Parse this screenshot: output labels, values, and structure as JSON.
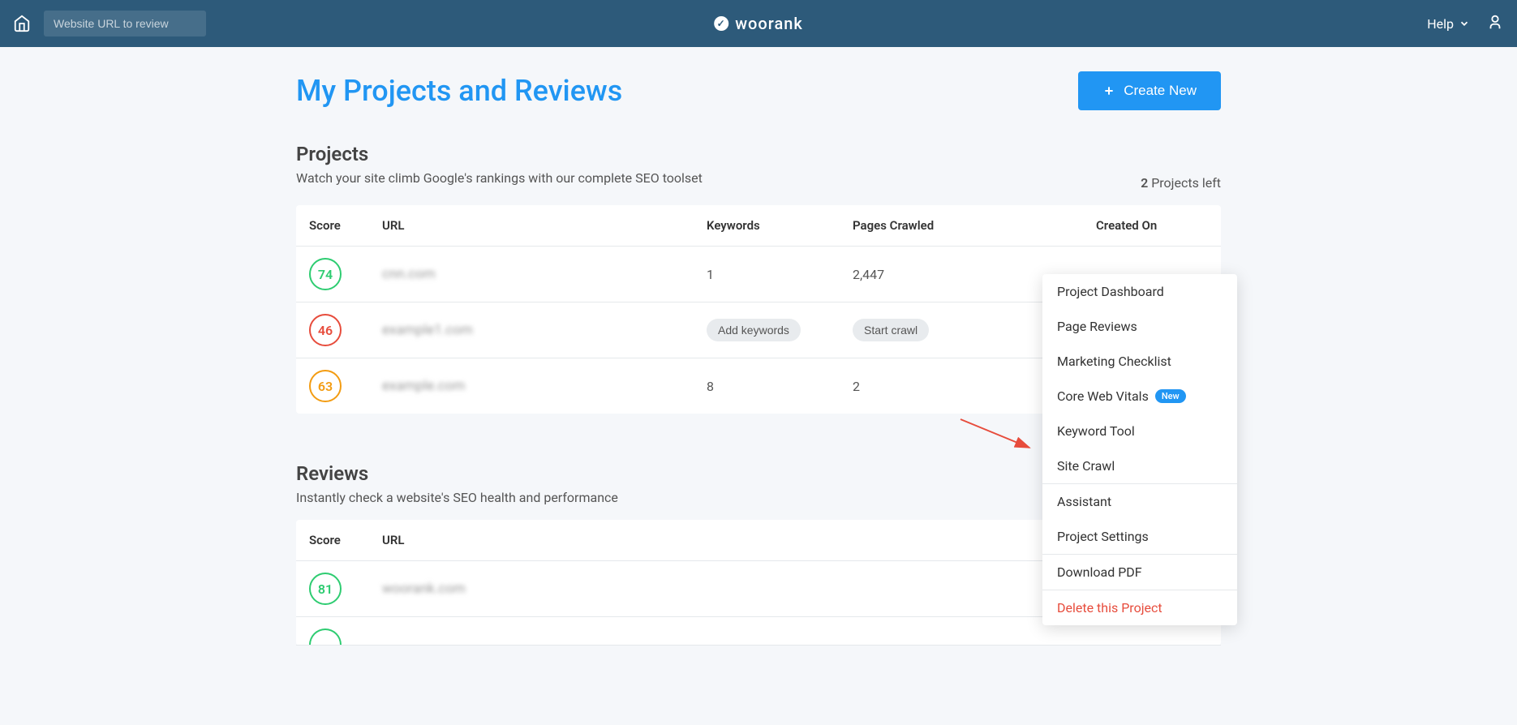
{
  "topbar": {
    "url_placeholder": "Website URL to review",
    "logo_text": "woorank",
    "help_label": "Help"
  },
  "page": {
    "title": "My Projects and Reviews",
    "create_btn_label": "Create New"
  },
  "projects": {
    "section_title": "Projects",
    "section_subtitle": "Watch your site climb Google's rankings with our complete SEO toolset",
    "left_text": "Projects left",
    "left_count": "2",
    "columns": {
      "score": "Score",
      "url": "URL",
      "keywords": "Keywords",
      "pages_crawled": "Pages Crawled",
      "created_on": "Created On"
    },
    "rows": [
      {
        "score": "74",
        "score_class": "score-green",
        "url": "cnn.com",
        "keywords": "1",
        "pages_crawled": "2,447"
      },
      {
        "score": "46",
        "score_class": "score-red",
        "url": "example1.com",
        "keywords_action": "Add keywords",
        "pages_action": "Start crawl"
      },
      {
        "score": "63",
        "score_class": "score-orange",
        "url": "example.com",
        "keywords": "8",
        "pages_crawled": "2"
      }
    ]
  },
  "reviews": {
    "section_title": "Reviews",
    "section_subtitle": "Instantly check a website's SEO health and performance",
    "columns": {
      "score": "Score",
      "url": "URL"
    },
    "rows": [
      {
        "score": "81",
        "score_class": "score-green",
        "url": "woorank.com"
      }
    ]
  },
  "dropdown": {
    "items": [
      {
        "label": "Project Dashboard"
      },
      {
        "label": "Page Reviews"
      },
      {
        "label": "Marketing Checklist"
      },
      {
        "label": "Core Web Vitals",
        "badge": "New"
      },
      {
        "label": "Keyword Tool"
      },
      {
        "label": "Site Crawl"
      }
    ],
    "items2": [
      {
        "label": "Assistant"
      },
      {
        "label": "Project Settings"
      }
    ],
    "items3": [
      {
        "label": "Download PDF"
      }
    ],
    "delete_label": "Delete this Project"
  }
}
